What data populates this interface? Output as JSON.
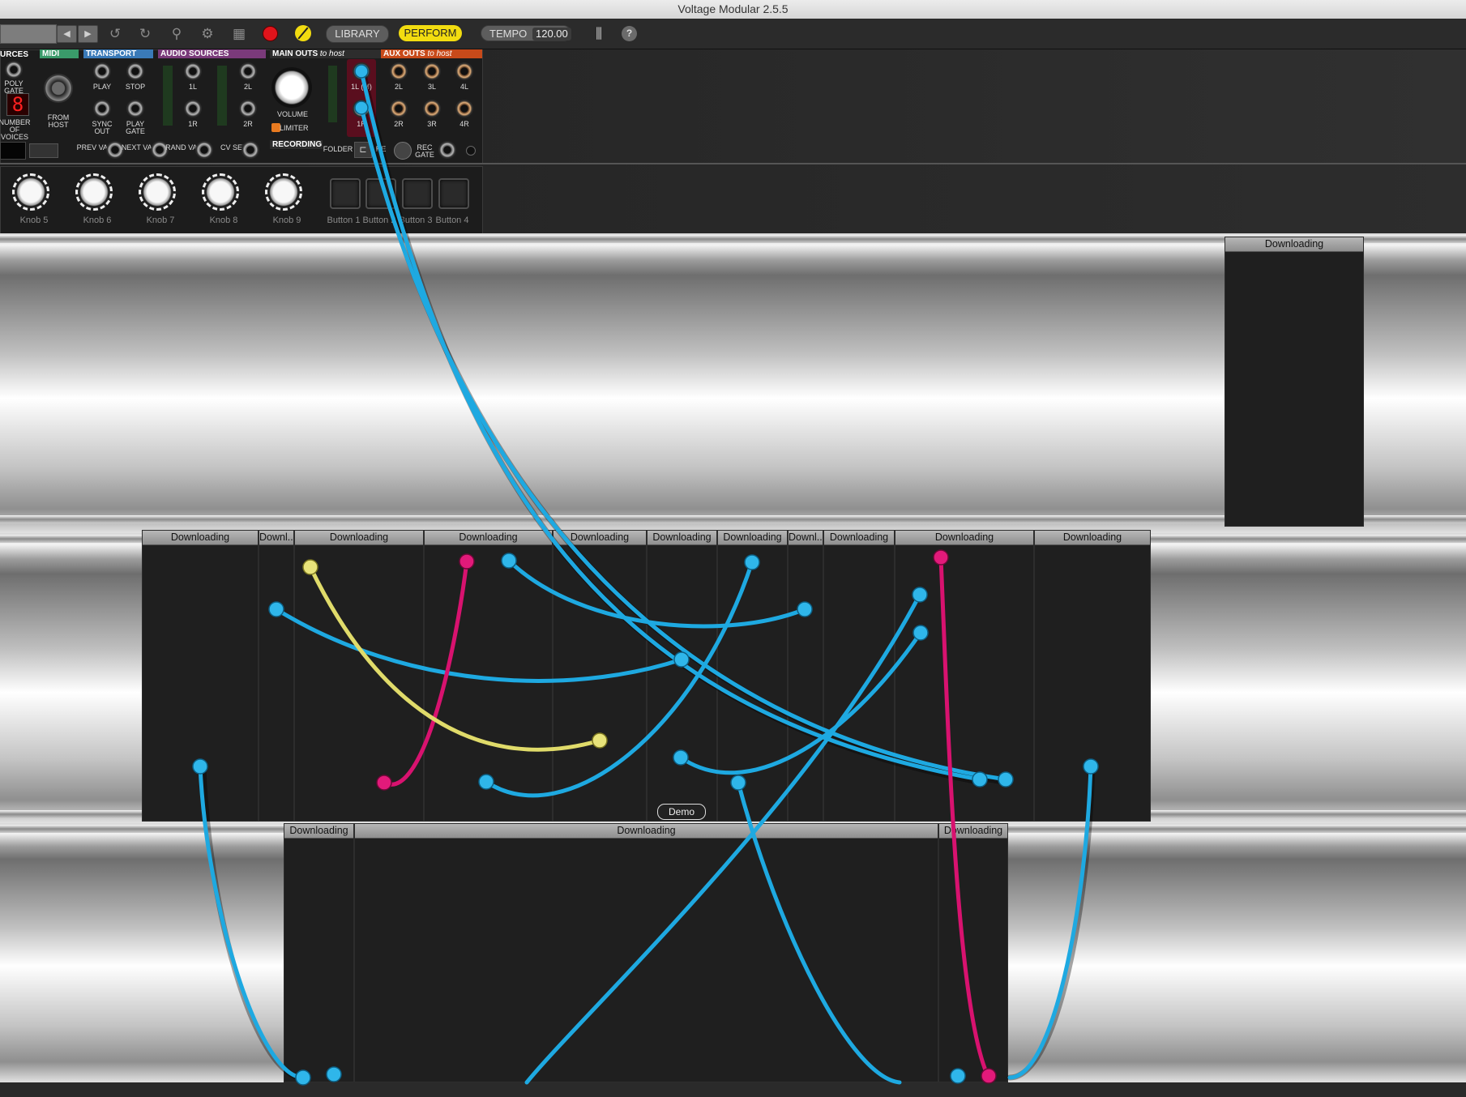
{
  "window": {
    "title": "Voltage Modular 2.5.5"
  },
  "toolbar": {
    "library_label": "LIBRARY",
    "perform_label": "PERFORM",
    "tempo_label": "TEMPO",
    "tempo_value": "120.00",
    "help_label": "?",
    "icons": [
      "left-arrow-icon",
      "right-arrow-icon",
      "undo-icon",
      "redo-icon",
      "zoom-icon",
      "gear-icon",
      "grid-icon",
      "record-icon",
      "bypass-icon",
      "midi-keyboard-icon",
      "help-icon"
    ],
    "accent_perform": "#f2dc10",
    "accent_record": "#e0141b"
  },
  "host_panel": {
    "sections": {
      "sources": "URCES",
      "midi": "MIDI",
      "transport": "TRANSPORT",
      "audio_sources": "AUDIO SOURCES",
      "main_outs": "MAIN OUTS",
      "main_outs_suffix": "to host",
      "aux_outs": "AUX OUTS",
      "aux_outs_suffix": "to host",
      "recording": "RECORDING"
    },
    "poly_gate": "POLY GATE",
    "voices_display": "8",
    "number_of_voices": "NUMBER OF VOICES",
    "from_host": "FROM HOST",
    "transport_labels": [
      "PLAY",
      "STOP",
      "SYNC OUT",
      "PLAY GATE"
    ],
    "audio_source_labels": [
      "1L",
      "2L",
      "1R",
      "2R"
    ],
    "volume_label": "VOLUME",
    "limiter_label": "LIMITER",
    "main_out_labels": [
      "1L (M)",
      "1R"
    ],
    "aux_out_labels": [
      "2L",
      "3L",
      "4L",
      "2R",
      "3R",
      "4R"
    ],
    "bottom_labels": [
      "PREV VAR",
      "NEXT VAR",
      "RAND VAR",
      "CV SEL"
    ],
    "folder_label": "FOLDER",
    "rec_gate_label": "REC GATE",
    "re_label": "RE"
  },
  "perform_panel": {
    "knobs": [
      "Knob 5",
      "Knob 6",
      "Knob 7",
      "Knob 8",
      "Knob 9"
    ],
    "buttons": [
      "Button 1",
      "Button 2",
      "Button 3",
      "Button 4"
    ]
  },
  "modules": {
    "rack2": [
      "Downloading"
    ],
    "rack3": [
      "Downloading",
      "Downl...",
      "Downloading",
      "Downloading",
      "Downloading",
      "Downloading",
      "Downloading",
      "Downl...",
      "Downloading",
      "Downloading",
      "Downloading"
    ],
    "rack4": [
      "Downloading",
      "Downloading",
      "Downloading"
    ]
  },
  "demo_label": "Demo",
  "cable_colors": {
    "blue": "#1ea9e1",
    "magenta": "#d8126f",
    "yellow": "#e0db6a"
  }
}
